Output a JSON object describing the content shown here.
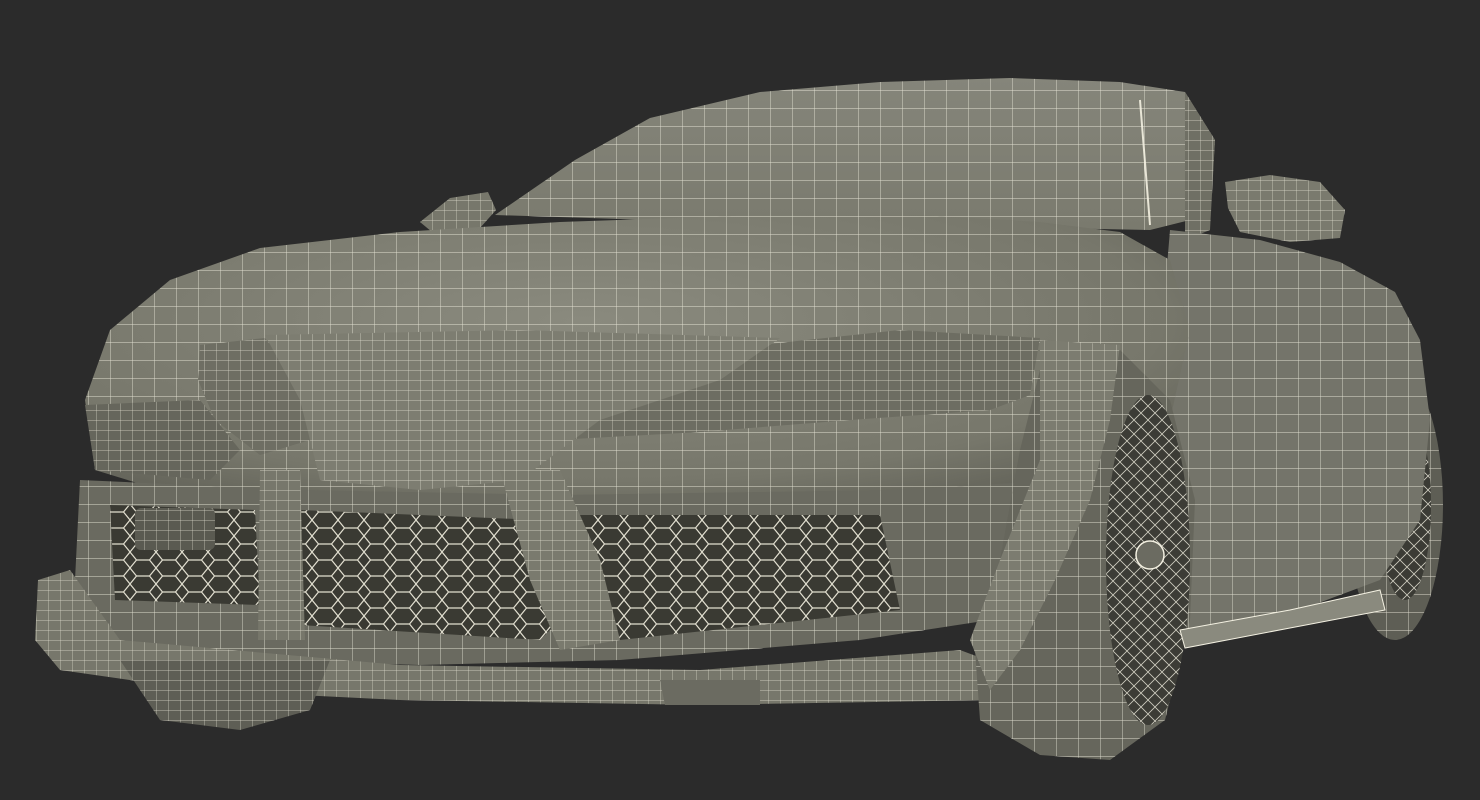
{
  "scene": {
    "subject": "sports-car",
    "style": "wireframe-over-clay",
    "colors": {
      "background": "#2b2b2b",
      "body_fill": "#7b7b6f",
      "body_shadow": "#4e4e45",
      "body_highlight": "#8c8c80",
      "wire": "#f4f1e2",
      "grille_dark": "#3a3a33"
    }
  }
}
